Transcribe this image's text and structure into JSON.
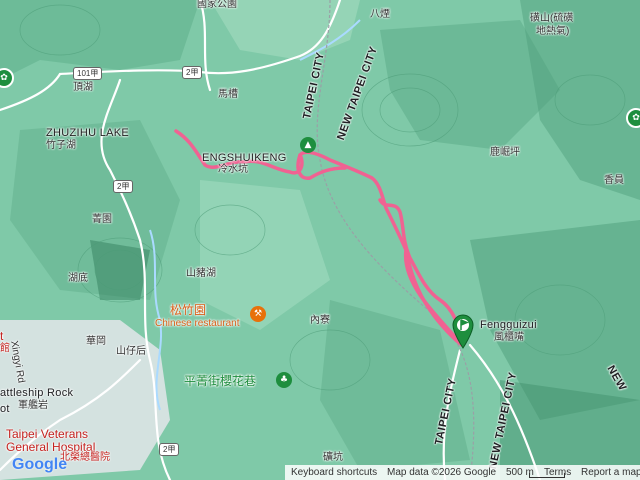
{
  "map": {
    "colors": {
      "terrain": "#7fc9a8",
      "road": "#ffffff",
      "river": "#aadaff",
      "route": "#f06292",
      "urban": "#e3e6ea"
    },
    "labels": {
      "guozhu": "國家公園",
      "bayan": "八煙",
      "linshan": "磺山(硫磺",
      "dire": "地熱氣)",
      "dinghu": "頂湖",
      "macao": "馬槽",
      "zhuzihu_en": "ZHUZIHU LAKE",
      "zhuzihu_zh": "竹子湖",
      "lengshuikeng_en": "ENGSHUIKENG",
      "lengshuikeng_zh": "冷水坑",
      "lujueping": "鹿崛坪",
      "xiangguan": "香員",
      "jiaoyuan": "菁園",
      "shanzhuhu": "山豬湖",
      "hudi": "湖底",
      "songzhuyuan": "松竹園",
      "chinese_restaurant": "Chinese restaurant",
      "neiliao": "內寮",
      "fengguizui_en": "Fengguizui",
      "fengguizui_zh": "風櫃嘴",
      "huagang": "華岡",
      "shanzaihou": "山仔后",
      "xingyi_rd": "Xingyi Rd",
      "rattleship": "attleship Rock",
      "junjianyan": "軍艦岩",
      "pingqing": "平菁街櫻花巷",
      "veterans1": "Taipei Veterans",
      "veterans2": "General Hospital",
      "veterans_zh": "北榮總醫院",
      "diankeng": "礦坑",
      "taipei_city_top": "TAIPEI CITY",
      "new_taipei_top": "NEW TAIPEI CITY",
      "taipei_city_bot": "TAIPEI CITY",
      "new_taipei_bot": "NEW TAIPEI CITY",
      "new_edge": "NEW",
      "taipei_left": "t",
      "hospital_left": "館",
      "ot_left": "ot"
    },
    "shields": {
      "r101a": "101甲",
      "r2a_top": "2甲",
      "r2a_mid": "2甲",
      "r2a_bot": "2甲"
    },
    "icons": {
      "start_marker": "flag-pin-icon",
      "summit_poi": "mountain-poi-icon",
      "restaurant": "restaurant-icon",
      "park": "park-icon",
      "attraction": "attraction-icon"
    }
  },
  "footer": {
    "google": "Google",
    "shortcuts": "Keyboard shortcuts",
    "mapdata": "Map data ©2026 Google",
    "scale": "500 m",
    "terms": "Terms",
    "report": "Report a map error"
  }
}
